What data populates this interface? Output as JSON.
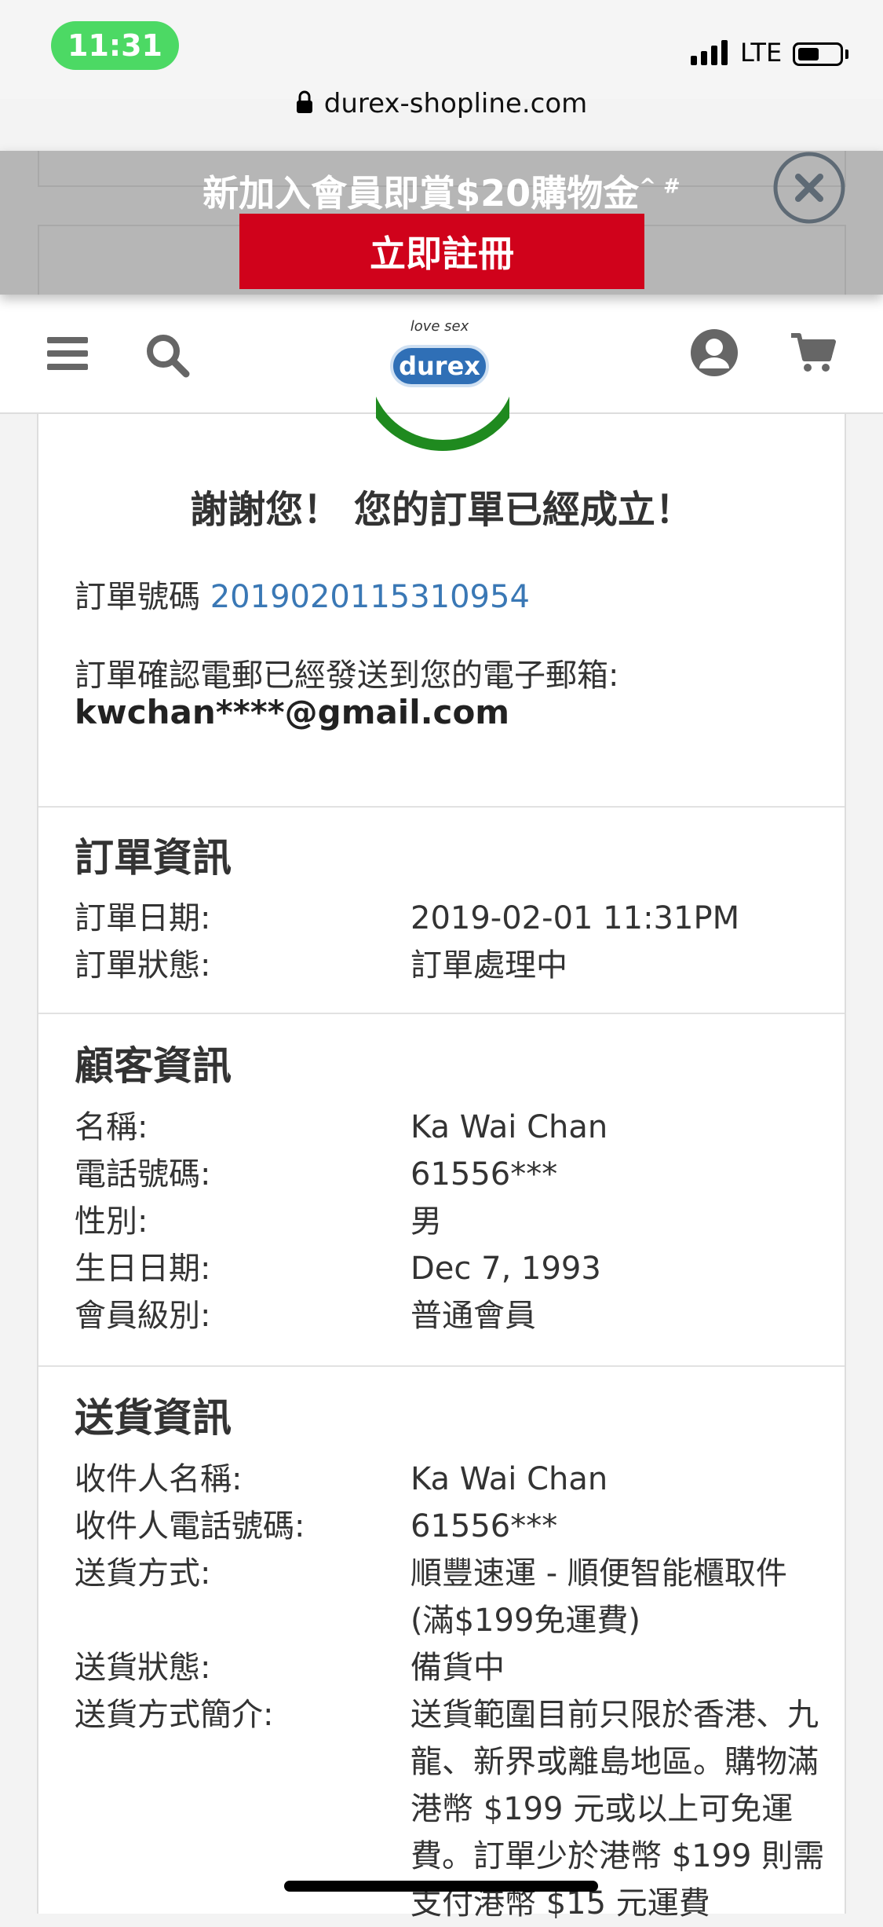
{
  "status_bar": {
    "time": "11:31",
    "network": "LTE",
    "url": "durex-shopline.com"
  },
  "promo": {
    "text": "新加入會員即賞$20購物金",
    "marks": "^ #",
    "button_label": "立即註冊"
  },
  "header": {
    "logo_tagline": "love sex",
    "logo_text": "durex"
  },
  "confirmation": {
    "thanks": "謝謝您！ 您的訂單已經成立！",
    "order_number_label": "訂單號碼",
    "order_number": "2019020115310954",
    "email_note": "訂單確認電郵已經發送到您的電子郵箱:",
    "email": "kwchan****@gmail.com"
  },
  "order_info": {
    "title": "訂單資訊",
    "rows": [
      {
        "label": "訂單日期:",
        "value": "2019-02-01 11:31PM"
      },
      {
        "label": "訂單狀態:",
        "value": "訂單處理中"
      }
    ]
  },
  "customer_info": {
    "title": "顧客資訊",
    "rows": [
      {
        "label": "名稱:",
        "value": "Ka Wai Chan"
      },
      {
        "label": "電話號碼:",
        "value": "61556***"
      },
      {
        "label": "性別:",
        "value": "男"
      },
      {
        "label": "生日日期:",
        "value": "Dec 7, 1993"
      },
      {
        "label": "會員級別:",
        "value": "普通會員"
      }
    ]
  },
  "delivery_info": {
    "title": "送貨資訊",
    "rows": [
      {
        "label": "收件人名稱:",
        "value": "Ka Wai Chan"
      },
      {
        "label": "收件人電話號碼:",
        "value": "61556***"
      },
      {
        "label": "送貨方式:",
        "value": "順豐速運 - 順便智能櫃取件 (滿$199免運費)"
      },
      {
        "label": "送貨狀態:",
        "value": "備貨中"
      },
      {
        "label": "送貨方式簡介:",
        "value": "送貨範圍目前只限於香港、九龍、新界或離島地區。購物滿港幣 $199 元或以上可免運費。訂單少於港幣 $199 則需支付港幣 $15 元運費"
      }
    ]
  },
  "colors": {
    "promo_button": "#d0021b",
    "order_link": "#3a78b5",
    "time_pill": "#4cd964",
    "success_check": "#1f8a1f"
  }
}
